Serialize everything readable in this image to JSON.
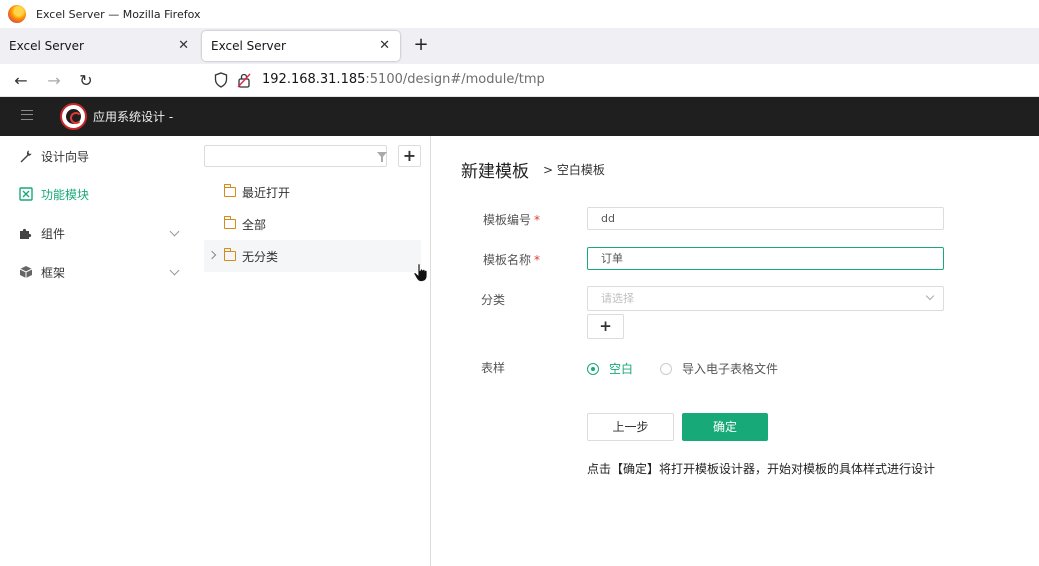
{
  "window": {
    "title": "Excel Server — Mozilla Firefox"
  },
  "tabs": [
    {
      "label": "Excel Server",
      "active": false
    },
    {
      "label": "Excel Server",
      "active": true
    }
  ],
  "address": {
    "host": "192.168.31.185",
    "path": ":5100/design#/module/tmp"
  },
  "app": {
    "title": "应用系统设计 -"
  },
  "sidebar": {
    "items": [
      {
        "label": "设计向导",
        "icon": "wrench-icon"
      },
      {
        "label": "功能模块",
        "icon": "module-icon",
        "active": true
      },
      {
        "label": "组件",
        "icon": "puzzle-icon",
        "expandable": true
      },
      {
        "label": "框架",
        "icon": "cube-icon",
        "expandable": true
      }
    ]
  },
  "tree": {
    "search_value": "",
    "items": [
      {
        "label": "最近打开"
      },
      {
        "label": "全部"
      },
      {
        "label": "无分类",
        "expandable": true
      }
    ]
  },
  "form": {
    "title": "新建模板",
    "breadcrumb": "> 空白模板",
    "code_label": "模板编号",
    "code_value": "dd",
    "name_label": "模板名称",
    "name_value": "订单",
    "category_label": "分类",
    "category_placeholder": "请选择",
    "sample_label": "表样",
    "sample_options": [
      {
        "label": "空白",
        "selected": true
      },
      {
        "label": "导入电子表格文件",
        "selected": false
      }
    ],
    "prev_label": "上一步",
    "ok_label": "确定",
    "note": "点击【确定】将打开模板设计器，开始对模板的具体样式进行设计"
  },
  "colors": {
    "accent": "#18a979",
    "header_bg": "#1f1f1f",
    "required": "#e53935",
    "folder": "#d68a1c"
  }
}
